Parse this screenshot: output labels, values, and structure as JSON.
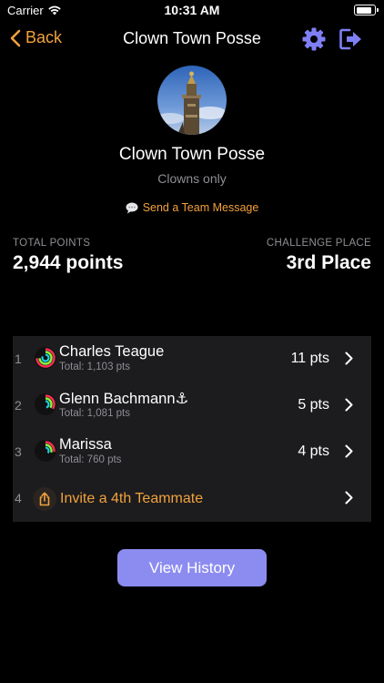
{
  "status_bar": {
    "carrier": "Carrier",
    "time": "10:31 AM",
    "battery_level": 0.92
  },
  "nav": {
    "back_label": "Back",
    "title": "Clown Town Posse",
    "icons": [
      "chevron-left-icon",
      "gear-icon",
      "exit-icon"
    ]
  },
  "team": {
    "name": "Clown Town Posse",
    "subtitle": "Clowns only",
    "message_link": "Send a Team Message"
  },
  "stats": {
    "total_points_label": "TOTAL POINTS",
    "total_points_value": "2,944 points",
    "challenge_place_label": "CHALLENGE PLACE",
    "challenge_place_value": "3rd Place"
  },
  "roster": {
    "members": [
      {
        "rank": "1",
        "name": "Charles Teague",
        "badge": "",
        "total": "Total: 1,103 pts",
        "points": "11 pts"
      },
      {
        "rank": "2",
        "name": "Glenn Bachmann",
        "badge": "⚓",
        "total": "Total: 1,081 pts",
        "points": "5 pts"
      },
      {
        "rank": "3",
        "name": "Marissa",
        "badge": "",
        "total": "Total: 760 pts",
        "points": "4 pts"
      }
    ],
    "invite": {
      "rank": "4",
      "label": "Invite a 4th Teammate"
    }
  },
  "history_button": "View History",
  "colors": {
    "accent_orange": "#f2a13c",
    "accent_purple": "#8c8cf0",
    "background": "#000000",
    "card": "#1c1c1e",
    "secondary_text": "#8e8e93"
  }
}
